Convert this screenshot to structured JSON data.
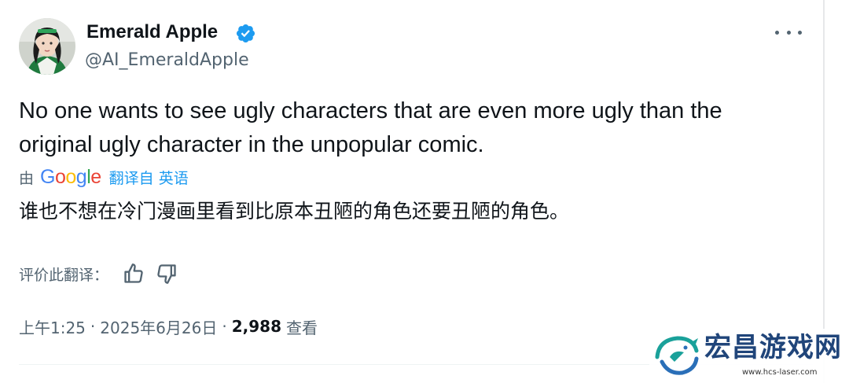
{
  "author": {
    "display_name": "Emerald Apple",
    "handle": "@AI_EmeraldApple",
    "verified": true,
    "avatar": "avatar-icon"
  },
  "tweet": {
    "text_lines": [
      "No one wants to see ugly characters that are even more ugly than the",
      "original ugly character in the unpopular comic."
    ]
  },
  "translation": {
    "by_label": "由",
    "provider": "Google",
    "source_link": "翻译自 英语",
    "text": "谁也不想在冷门漫画里看到比原本丑陋的角色还要丑陋的角色。"
  },
  "rating": {
    "label": "评价此翻译：",
    "like_icon": "thumbs-up-icon",
    "dislike_icon": "thumbs-down-icon"
  },
  "meta": {
    "time": "上午1:25",
    "separator": "·",
    "date": "2025年6月26日",
    "views_count": "2,988",
    "views_label": "查看"
  },
  "menu": {
    "more_icon": "more-options-icon"
  },
  "watermark": {
    "title": "宏昌游戏网",
    "url": "www.hcs-laser.com"
  },
  "colors": {
    "accent": "#1d9bf0",
    "secondary_text": "#536471",
    "primary_text": "#0f1419",
    "watermark": "#20457a"
  }
}
